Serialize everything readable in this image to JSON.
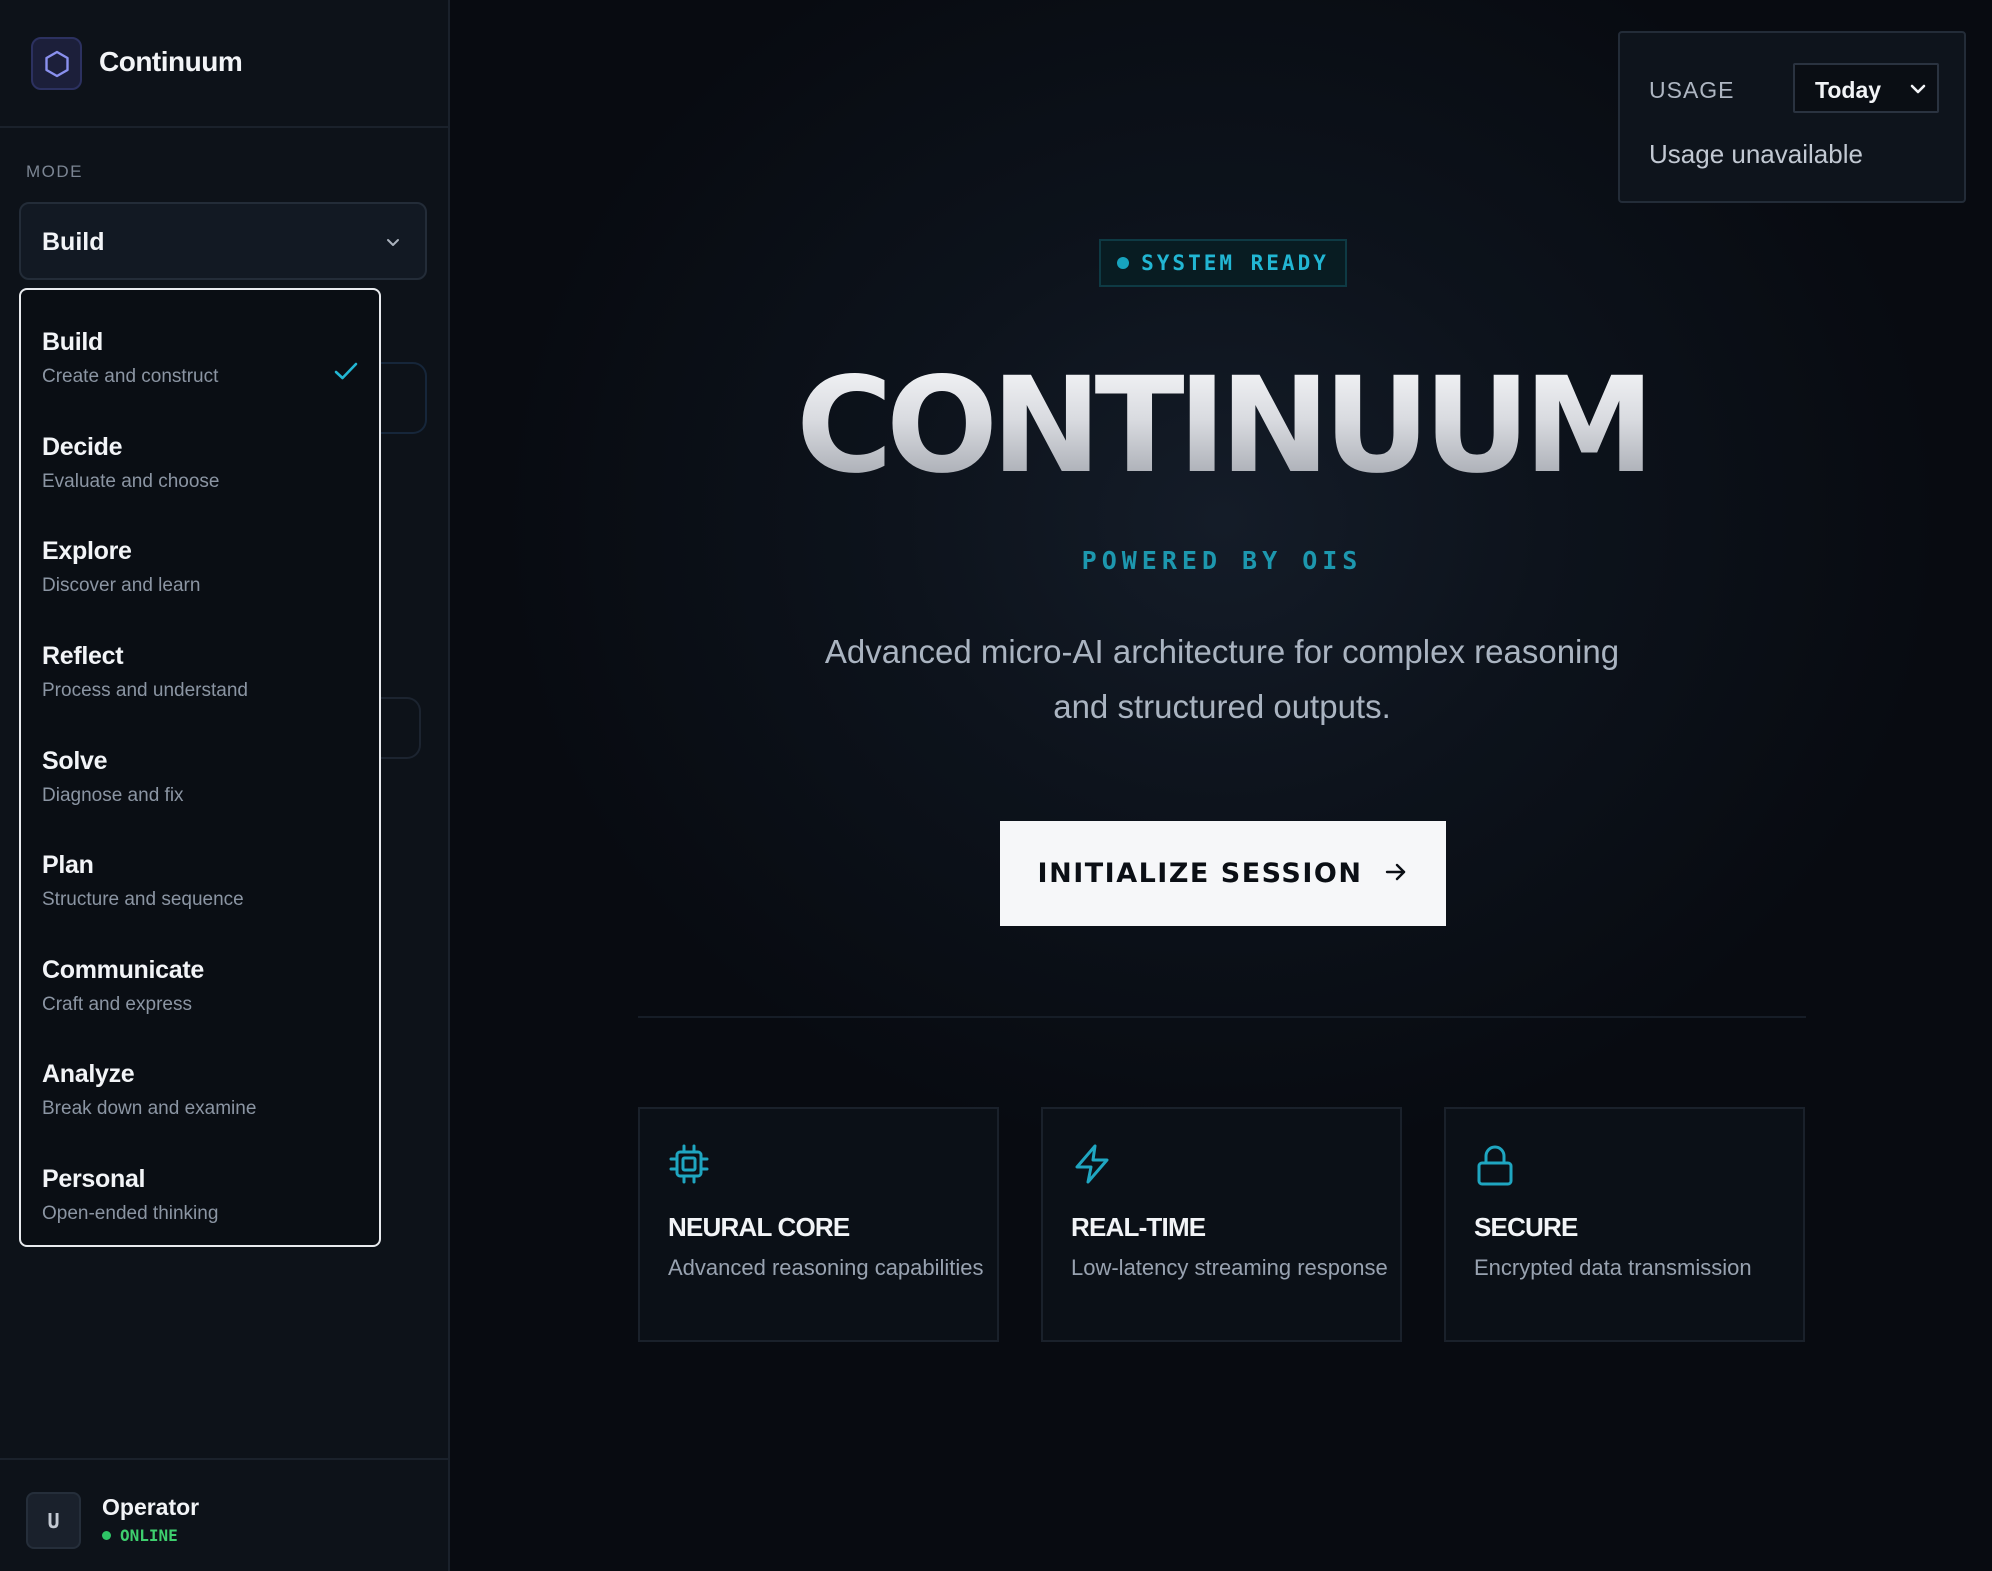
{
  "app": {
    "brand_name": "Continuum"
  },
  "sidebar": {
    "mode_label": "MODE",
    "mode_selected": "Build",
    "mode_options": [
      {
        "name": "Build",
        "desc": "Create and construct",
        "selected": true
      },
      {
        "name": "Decide",
        "desc": "Evaluate and choose"
      },
      {
        "name": "Explore",
        "desc": "Discover and learn"
      },
      {
        "name": "Reflect",
        "desc": "Process and understand"
      },
      {
        "name": "Solve",
        "desc": "Diagnose and fix"
      },
      {
        "name": "Plan",
        "desc": "Structure and sequence"
      },
      {
        "name": "Communicate",
        "desc": "Craft and express"
      },
      {
        "name": "Analyze",
        "desc": "Break down and examine"
      },
      {
        "name": "Personal",
        "desc": "Open-ended thinking"
      }
    ],
    "user": {
      "avatar_letter": "U",
      "name": "Operator",
      "status": "ONLINE"
    }
  },
  "usage": {
    "label": "USAGE",
    "period": "Today",
    "message": "Usage unavailable"
  },
  "hero": {
    "badge": "SYSTEM READY",
    "title": "CONTINUUM",
    "powered_by": "POWERED BY OIS",
    "description": "Advanced micro-AI architecture for complex reasoning and structured outputs.",
    "cta_label": "INITIALIZE SESSION"
  },
  "features": [
    {
      "icon": "cpu-chip-icon",
      "title": "NEURAL CORE",
      "desc": "Advanced reasoning capabilities"
    },
    {
      "icon": "lightning-bolt-icon",
      "title": "REAL-TIME",
      "desc": "Low-latency streaming response"
    },
    {
      "icon": "lock-icon",
      "title": "SECURE",
      "desc": "Encrypted data transmission"
    }
  ],
  "colors": {
    "accent_cyan": "#22b6d3",
    "status_green": "#2ec466",
    "background": "#080b11",
    "sidebar_bg": "#0d1219",
    "cta_bg": "#f6f7f9"
  }
}
